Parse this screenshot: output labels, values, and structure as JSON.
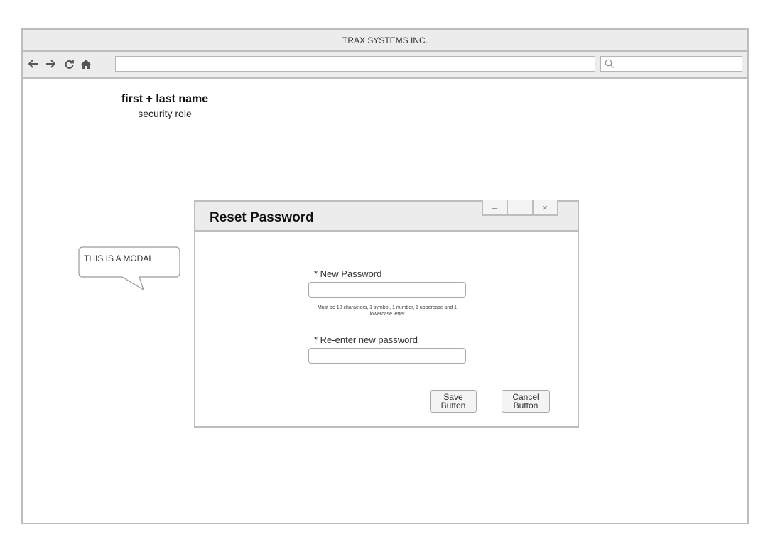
{
  "window": {
    "title": "TRAX SYSTEMS INC."
  },
  "browser": {
    "nav_icons": [
      "back-arrow-icon",
      "forward-arrow-icon",
      "reload-icon",
      "home-icon"
    ],
    "url": "",
    "search_value": ""
  },
  "user": {
    "name": "first + last name",
    "role": "security role"
  },
  "callout": {
    "text": "THIS IS A MODAL"
  },
  "modal": {
    "title": "Reset Password",
    "controls": {
      "minimize": "–",
      "maximize": "",
      "close": "×"
    },
    "new_password": {
      "label": "* New Password",
      "value": ""
    },
    "hint": "Must be 10 characters, 1 symbol, 1 number, 1 uppercase and 1 lowercase letter",
    "reenter_password": {
      "label": "* Re-enter new password",
      "value": ""
    },
    "save_button": {
      "line1": "Save",
      "line2": "Button"
    },
    "cancel_button": {
      "line1": "Cancel",
      "line2": "Button"
    }
  },
  "colors": {
    "chrome_bg": "#ececec",
    "border": "#bdbdbd",
    "text": "#222222"
  }
}
